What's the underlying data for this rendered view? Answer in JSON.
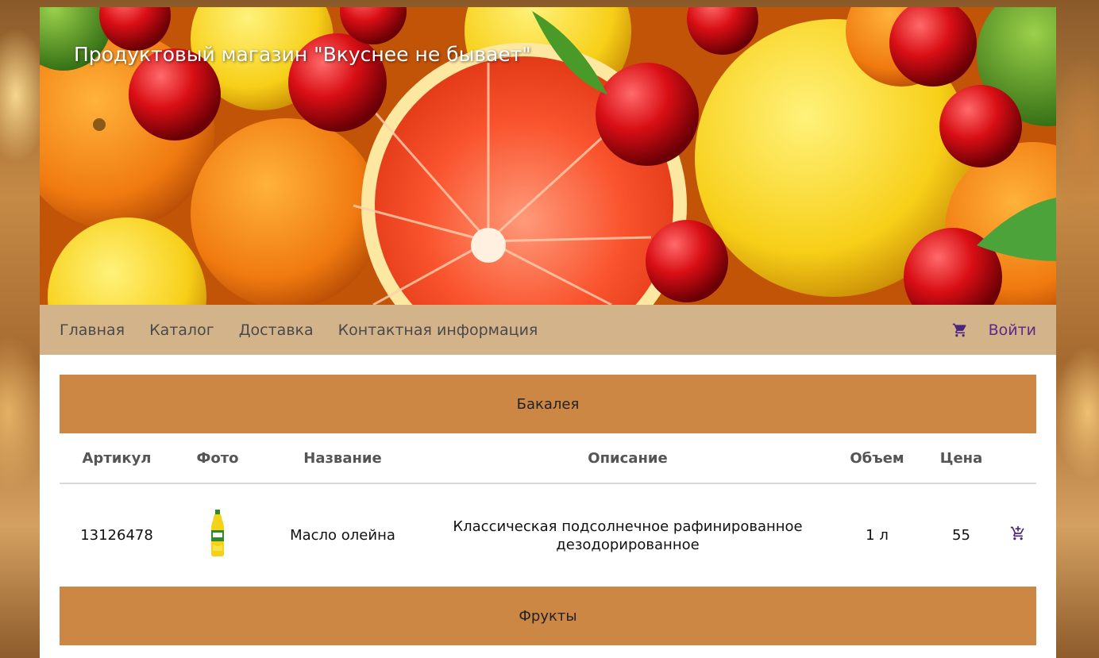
{
  "header": {
    "title": "Продуктовый магазин \"Вкуснее не бывает\""
  },
  "nav": {
    "items": [
      "Главная",
      "Каталог",
      "Доставка",
      "Контактная информация"
    ],
    "cart_icon": "cart-icon",
    "login_label": "Войти"
  },
  "categories": [
    {
      "name": "Бакалея",
      "columns": [
        "Артикул",
        "Фото",
        "Название",
        "Описание",
        "Объем",
        "Цена"
      ],
      "products": [
        {
          "article": "13126478",
          "photo_icon": "oil-bottle-image",
          "name": "Масло олейна",
          "description": "Классическая подсолнечное рафинированное дезодорированное",
          "volume": "1 л",
          "price": "55",
          "action_icon": "add-to-cart-icon"
        }
      ]
    },
    {
      "name": "Фрукты"
    }
  ],
  "colors": {
    "nav_bg": "#d3b38a",
    "category_bg": "#cd8744",
    "accent": "#5a2a86"
  }
}
